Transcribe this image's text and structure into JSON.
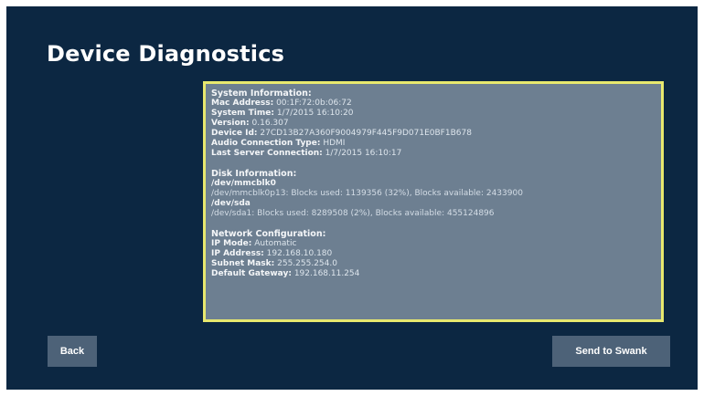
{
  "page": {
    "title": "Device Diagnostics"
  },
  "system": {
    "heading": "System Information:",
    "rows": [
      {
        "label": "Mac Address:",
        "value": "00:1F:72:0b:06:72"
      },
      {
        "label": "System Time:",
        "value": "1/7/2015 16:10:20"
      },
      {
        "label": "Version:",
        "value": "0.16.307"
      },
      {
        "label": "Device Id:",
        "value": "27CD13B27A360F9004979F445F9D071E0BF1B678"
      },
      {
        "label": "Audio Connection Type:",
        "value": "HDMI"
      },
      {
        "label": "Last Server Connection:",
        "value": "1/7/2015 16:10:17"
      }
    ]
  },
  "disk": {
    "heading": "Disk Information:",
    "devices": [
      {
        "name": "/dev/mmcblk0",
        "detail": "/dev/mmcblk0p13: Blocks used: 1139356 (32%), Blocks available: 2433900"
      },
      {
        "name": "/dev/sda",
        "detail": "/dev/sda1: Blocks used: 8289508 (2%), Blocks available: 455124896"
      }
    ]
  },
  "network": {
    "heading": "Network Configuration:",
    "rows": [
      {
        "label": "IP Mode:",
        "value": "Automatic"
      },
      {
        "label": "IP Address:",
        "value": "192.168.10.180"
      },
      {
        "label": "Subnet Mask:",
        "value": "255.255.254.0"
      },
      {
        "label": "Default Gateway:",
        "value": "192.168.11.254"
      }
    ]
  },
  "buttons": {
    "back": "Back",
    "send": "Send to Swank"
  },
  "colors": {
    "background": "#0c2742",
    "panel": "#6d7f91",
    "panel_border": "#e8e86e",
    "button": "#4d6278"
  }
}
